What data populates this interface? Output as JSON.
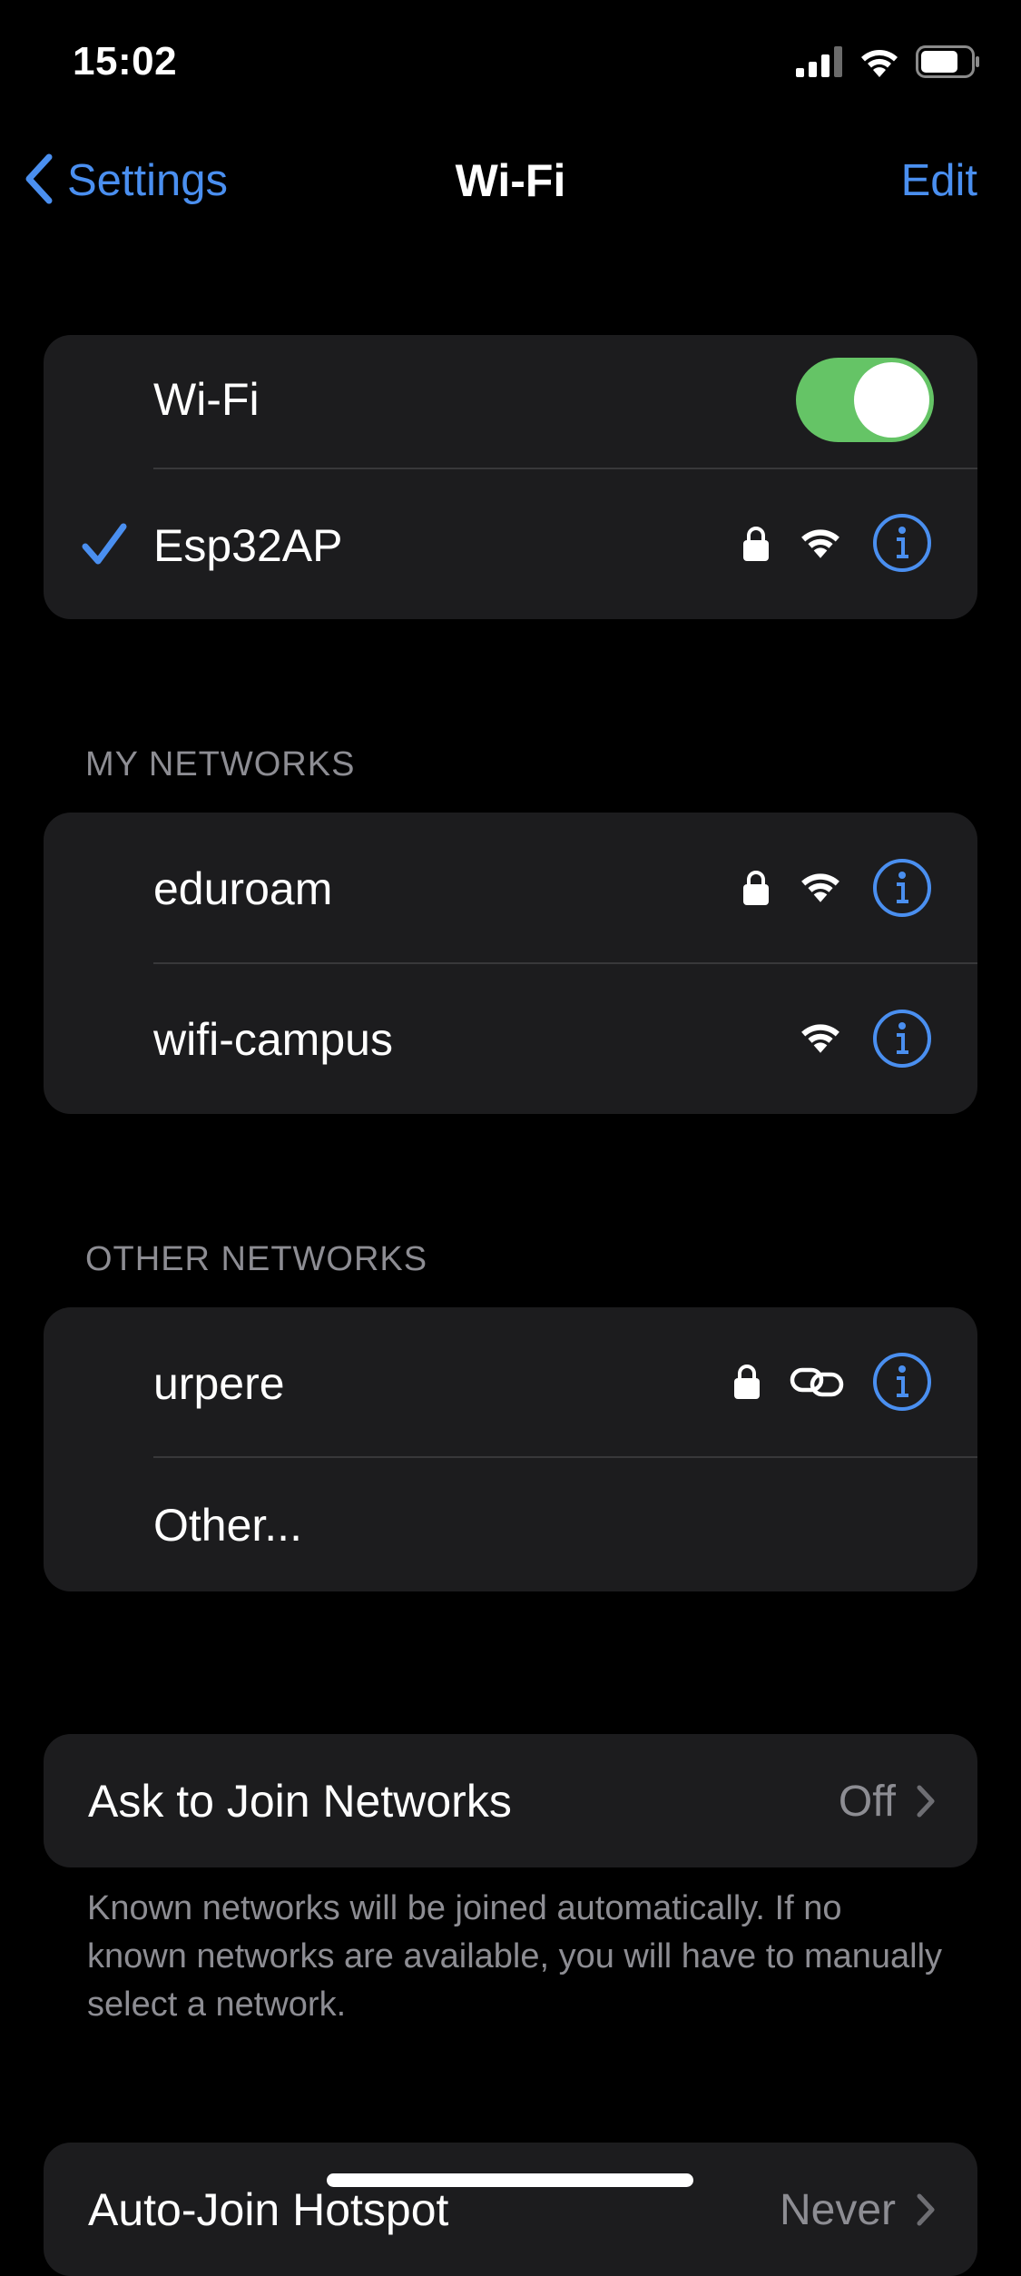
{
  "status_bar": {
    "time": "15:02",
    "icons": [
      "cellular-signal-icon",
      "wifi-icon",
      "battery-icon"
    ]
  },
  "nav": {
    "back_label": "Settings",
    "title": "Wi-Fi",
    "edit_label": "Edit"
  },
  "wifi_card": {
    "toggle_label": "Wi-Fi",
    "toggle_on": true,
    "connected_network": {
      "name": "Esp32AP",
      "secured": true,
      "icons": [
        "checkmark-icon",
        "lock-icon",
        "wifi-signal-icon",
        "info-icon"
      ]
    }
  },
  "my_networks": {
    "header": "MY NETWORKS",
    "items": [
      {
        "name": "eduroam",
        "secured": true,
        "icons": [
          "lock-icon",
          "wifi-signal-icon",
          "info-icon"
        ]
      },
      {
        "name": "wifi-campus",
        "secured": false,
        "icons": [
          "wifi-signal-icon",
          "info-icon"
        ]
      }
    ]
  },
  "other_networks": {
    "header": "OTHER NETWORKS",
    "items": [
      {
        "name": "urpere",
        "secured": true,
        "icons": [
          "lock-icon",
          "link-icon",
          "info-icon"
        ]
      },
      {
        "name": "Other..."
      }
    ]
  },
  "ask_to_join": {
    "label": "Ask to Join Networks",
    "value": "Off",
    "footnote": "Known networks will be joined automatically. If no known networks are available, you will have to manually select a network."
  },
  "auto_join_hotspot": {
    "label": "Auto-Join Hotspot",
    "value": "Never"
  },
  "colors": {
    "background": "#000000",
    "card": "#1c1c1e",
    "accent_blue": "#4a8ff0",
    "toggle_green": "#65c466",
    "secondary_text": "#8d8d93",
    "separator": "#38383a"
  }
}
